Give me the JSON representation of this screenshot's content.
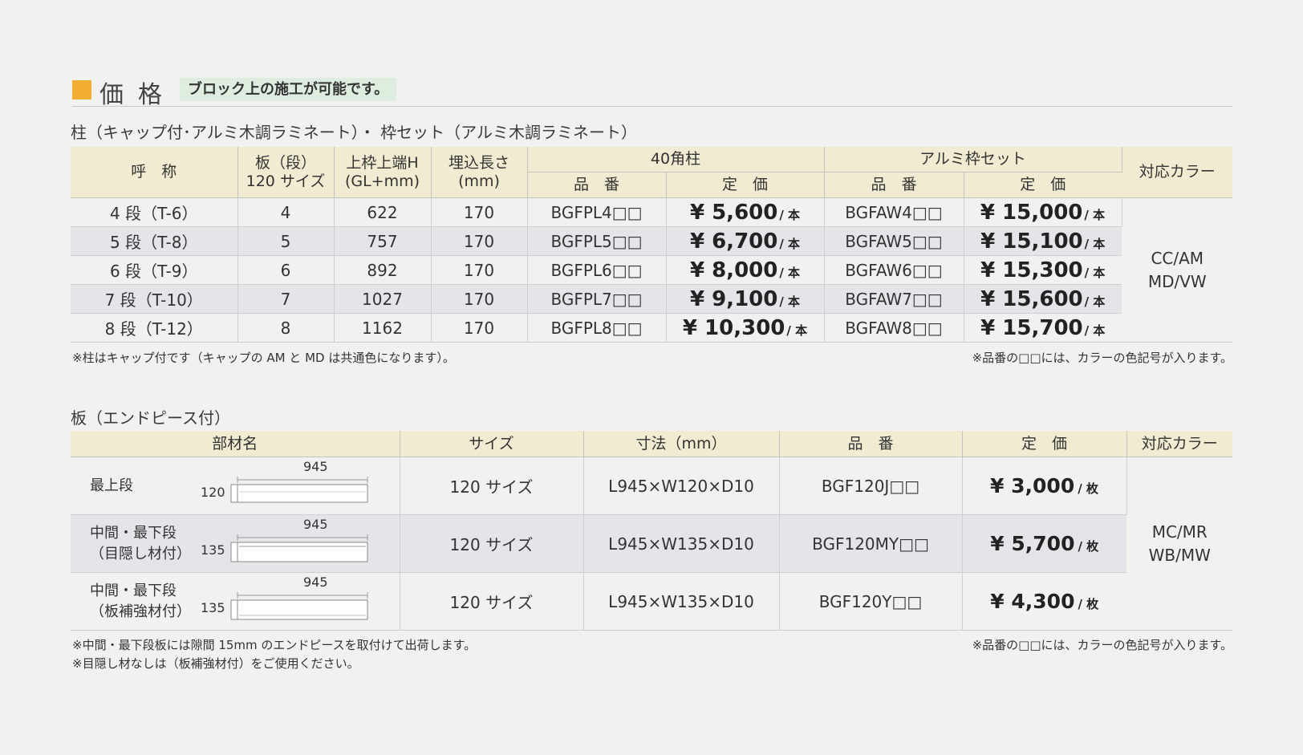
{
  "header": {
    "title": "価格",
    "badge": "ブロック上の施工が可能です。"
  },
  "section1": {
    "title": "柱（キャップ付･アルミ木調ラミネート）・ 枠セット（アルミ木調ラミネート）",
    "headers": {
      "name": "呼　称",
      "board_1": "板（段）",
      "board_2": "120 サイズ",
      "height_1": "上枠上端H",
      "height_2": "(GL+mm)",
      "embed_1": "埋込長さ",
      "embed_2": "(mm)",
      "post_group": "40角柱",
      "frame_group": "アルミ枠セット",
      "part_no": "品　番",
      "price": "定　価",
      "color": "対応カラー"
    },
    "price_unit": "/ 本",
    "rows": [
      {
        "name": "4 段（T-6）",
        "board": "4",
        "height": "622",
        "embed": "170",
        "post_no": "BGFPL4□□",
        "post_price": "¥ 5,600",
        "frame_no": "BGFAW4□□",
        "frame_price": "¥ 15,000"
      },
      {
        "name": "5 段（T-8）",
        "board": "5",
        "height": "757",
        "embed": "170",
        "post_no": "BGFPL5□□",
        "post_price": "¥ 6,700",
        "frame_no": "BGFAW5□□",
        "frame_price": "¥ 15,100"
      },
      {
        "name": "6 段（T-9）",
        "board": "6",
        "height": "892",
        "embed": "170",
        "post_no": "BGFPL6□□",
        "post_price": "¥ 8,000",
        "frame_no": "BGFAW6□□",
        "frame_price": "¥ 15,300"
      },
      {
        "name": "7 段（T-10）",
        "board": "7",
        "height": "1027",
        "embed": "170",
        "post_no": "BGFPL7□□",
        "post_price": "¥ 9,100",
        "frame_no": "BGFAW7□□",
        "frame_price": "¥ 15,600"
      },
      {
        "name": "8 段（T-12）",
        "board": "8",
        "height": "1162",
        "embed": "170",
        "post_no": "BGFPL8□□",
        "post_price": "¥ 10,300",
        "frame_no": "BGFAW8□□",
        "frame_price": "¥ 15,700"
      }
    ],
    "colors_1": "CC/AM",
    "colors_2": "MD/VW",
    "note_left": "※柱はキャップ付です（キャップの AM と MD は共通色になります）。",
    "note_right": "※品番の□□には、カラーの色記号が入ります。"
  },
  "section2": {
    "title": "板（エンドピース付）",
    "headers": {
      "member": "部材名",
      "size": "サイズ",
      "dim": "寸法（mm）",
      "part_no": "品　番",
      "price": "定　価",
      "color": "対応カラー"
    },
    "price_unit": "/ 枚",
    "rows": [
      {
        "name_1": "最上段",
        "name_2": "",
        "length": "945",
        "width": "120",
        "size": "120 サイズ",
        "dim": "L945×W120×D10",
        "part_no": "BGF120J□□",
        "price": "¥ 3,000"
      },
      {
        "name_1": "中間・最下段",
        "name_2": "（目隠し材付）",
        "length": "945",
        "width": "135",
        "size": "120 サイズ",
        "dim": "L945×W135×D10",
        "part_no": "BGF120MY□□",
        "price": "¥ 5,700"
      },
      {
        "name_1": "中間・最下段",
        "name_2": "（板補強材付）",
        "length": "945",
        "width": "135",
        "size": "120 サイズ",
        "dim": "L945×W135×D10",
        "part_no": "BGF120Y□□",
        "price": "¥ 4,300"
      }
    ],
    "colors_1": "MC/MR",
    "colors_2": "WB/MW",
    "note_left_1": "※中間・最下段板には隙間 15mm のエンドピースを取付けて出荷します。",
    "note_left_2": "※目隠し材なしは（板補強材付）をご使用ください。",
    "note_right": "※品番の□□には、カラーの色記号が入ります。"
  }
}
